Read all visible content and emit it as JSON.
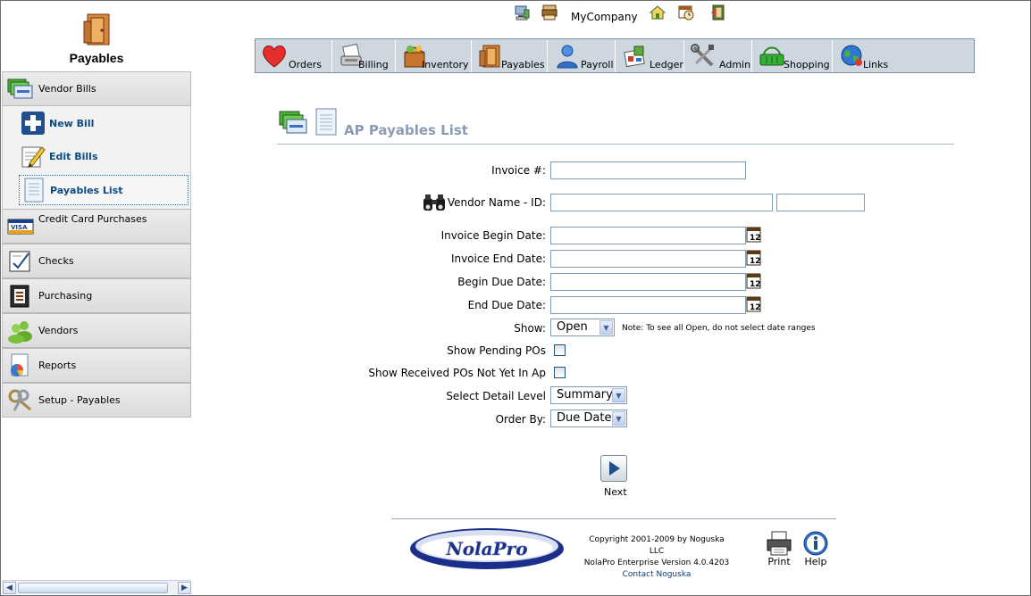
{
  "sidebar": {
    "brand": "Payables",
    "sections": [
      {
        "label": "Vendor Bills",
        "icon": "bills-icon"
      },
      {
        "label": "Credit Card Purchases",
        "icon": "visa-card-icon"
      },
      {
        "label": "Checks",
        "icon": "checks-icon"
      },
      {
        "label": "Purchasing",
        "icon": "purchasing-icon"
      },
      {
        "label": "Vendors",
        "icon": "vendors-icon"
      },
      {
        "label": "Reports",
        "icon": "reports-icon"
      },
      {
        "label": "Setup - Payables",
        "icon": "setup-keys-icon"
      }
    ],
    "subitems": [
      {
        "label": "New Bill",
        "icon": "plus-icon"
      },
      {
        "label": "Edit Bills",
        "icon": "edit-pencil-icon"
      },
      {
        "label": "Payables List",
        "icon": "list-page-icon",
        "active": true
      }
    ]
  },
  "top": {
    "company": "MyCompany",
    "icons": [
      "computer-icon",
      "printer-icon",
      "home-icon",
      "calendar-clock-icon",
      "logout-door-icon"
    ]
  },
  "nav": [
    {
      "label": "Orders",
      "icon": "heart-icon"
    },
    {
      "label": "Billing",
      "icon": "billing-icon"
    },
    {
      "label": "Inventory",
      "icon": "inventory-box-icon"
    },
    {
      "label": "Payables",
      "icon": "payables-door-icon"
    },
    {
      "label": "Payroll",
      "icon": "person-icon"
    },
    {
      "label": "Ledger",
      "icon": "ledger-icon"
    },
    {
      "label": "Admin",
      "icon": "tools-icon"
    },
    {
      "label": "Shopping",
      "icon": "shopping-basket-icon"
    },
    {
      "label": "Links",
      "icon": "globe-icon"
    }
  ],
  "page": {
    "title": "AP Payables List"
  },
  "form": {
    "invoice_label": "Invoice #:",
    "invoice_value": "",
    "vendor_label": "Vendor Name - ID:",
    "vendor_name_value": "",
    "vendor_id_value": "",
    "invoice_begin_label": "Invoice Begin Date:",
    "invoice_end_label": "Invoice End Date:",
    "begin_due_label": "Begin Due Date:",
    "end_due_label": "End Due Date:",
    "show_label": "Show:",
    "show_value": "Open",
    "show_note": "Note: To see all Open, do not select date ranges",
    "pending_label": "Show Pending POs",
    "received_label": "Show Received POs Not Yet In Ap",
    "detail_label": "Select Detail Level",
    "detail_value": "Summary",
    "order_label": "Order By:",
    "order_value": "Due Date"
  },
  "actions": {
    "next_label": "Next"
  },
  "footer": {
    "logo_text": "NolaPro",
    "copyright": "Copyright 2001-2009 by Noguska LLC",
    "version": "NolaPro Enterprise Version 4.0.4203",
    "contact": "Contact Noguska",
    "print_label": "Print",
    "help_label": "Help"
  },
  "colors": {
    "nav_bg": "#ced7e0",
    "title": "#8b9bb3",
    "link": "#0a4b84"
  }
}
